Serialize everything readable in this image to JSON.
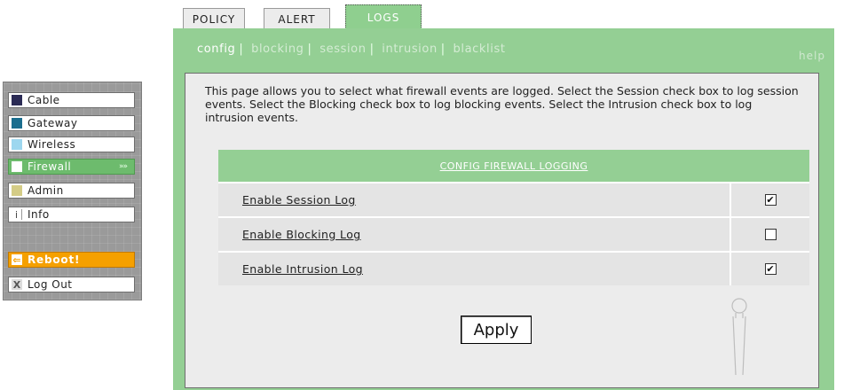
{
  "nav": {
    "items": [
      {
        "label": "Cable",
        "swatch": "#2b2b55"
      },
      {
        "label": "Gateway",
        "swatch": "#1a6d8e"
      },
      {
        "label": "Wireless",
        "swatch": "#9dd7ef"
      },
      {
        "label": "Firewall",
        "chevron": "»»"
      },
      {
        "label": "Admin",
        "swatch": "#d4cc86"
      },
      {
        "label": "Info",
        "glyph": "i"
      },
      {
        "label": "Reboot!",
        "glyph": "⇐"
      },
      {
        "label": "Log Out",
        "glyph": "X"
      }
    ]
  },
  "tabs": [
    {
      "label": "POLICY"
    },
    {
      "label": "ALERT"
    },
    {
      "label": "LOGS"
    }
  ],
  "subnav": {
    "items": [
      "config",
      "blocking",
      "session",
      "intrusion",
      "blacklist"
    ],
    "help": "help"
  },
  "content": {
    "intro": "This page allows you to select what firewall events are logged. Select the Session check box to log session events. Select the Blocking check box to log blocking events. Select the Intrusion check box to log intrusion events.",
    "table_title": "CONFIG FIREWALL LOGGING",
    "rows": [
      {
        "label": "Enable Session Log",
        "checked": true
      },
      {
        "label": "Enable Blocking Log",
        "checked": false
      },
      {
        "label": "Enable Intrusion Log",
        "checked": true
      }
    ],
    "apply_label": "Apply"
  },
  "colors": {
    "accent_green": "#94cf94",
    "active_nav_green": "#6dbb6d",
    "reboot_orange": "#f5a000"
  }
}
